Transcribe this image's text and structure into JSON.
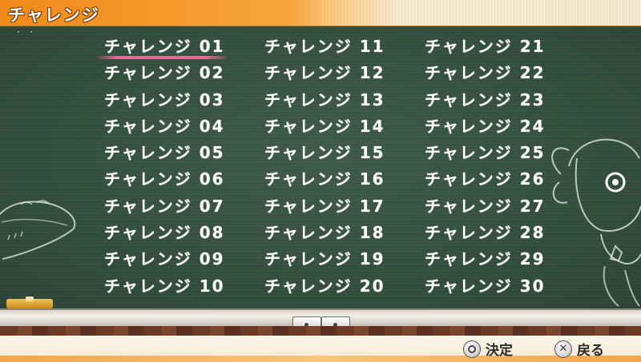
{
  "header": {
    "title": "チャレンジ"
  },
  "board": {
    "corner_marks": "· ·"
  },
  "challenges": {
    "col1": [
      "チャレンジ 01",
      "チャレンジ 02",
      "チャレンジ 03",
      "チャレンジ 04",
      "チャレンジ 05",
      "チャレンジ 06",
      "チャレンジ 07",
      "チャレンジ 08",
      "チャレンジ 09",
      "チャレンジ 10"
    ],
    "col2": [
      "チャレンジ 11",
      "チャレンジ 12",
      "チャレンジ 13",
      "チャレンジ 14",
      "チャレンジ 15",
      "チャレンジ 16",
      "チャレンジ 17",
      "チャレンジ 18",
      "チャレンジ 19",
      "チャレンジ 20"
    ],
    "col3": [
      "チャレンジ 21",
      "チャレンジ 22",
      "チャレンジ 23",
      "チャレンジ 24",
      "チャレンジ 25",
      "チャレンジ 26",
      "チャレンジ 27",
      "チャレンジ 28",
      "チャレンジ 29",
      "チャレンジ 30"
    ],
    "selected": "チャレンジ 01"
  },
  "footer": {
    "confirm_button_icon": "circle-button-icon",
    "confirm_label": "決定",
    "back_button_icon": "cross-button-icon",
    "back_label": "戻る"
  },
  "colors": {
    "chalkboard": "#35503f",
    "header_orange": "#f08a1a",
    "selection_underline": "#e86a97",
    "chalk_text": "#ffffff"
  }
}
